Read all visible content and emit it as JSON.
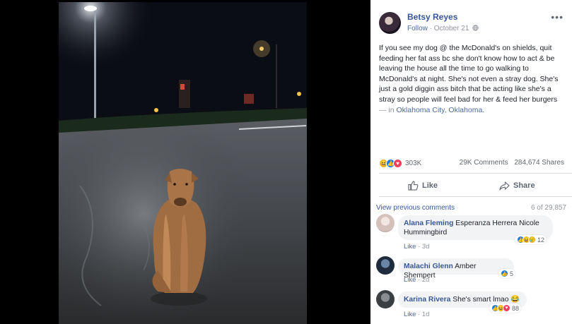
{
  "post": {
    "author": "Betsy Reyes",
    "follow": "Follow",
    "date": "October 21",
    "text": "If you see my dog @ the McDonald's on shields, quit feeding her fat ass bc she don't know how to act & be leaving the house all the time to go walking to McDonald's at night. She's not even a stray dog. She's just a gold diggin ass bitch that be acting like she's a stray so people will feel bad for her & feed her burgers",
    "location_prefix": "— in",
    "location": "Oklahoma City, Oklahoma.",
    "more_icon": "•••"
  },
  "stats": {
    "reactions": "303K",
    "comments": "29K Comments",
    "shares": "284,674 Shares"
  },
  "actions": {
    "like": "Like",
    "share": "Share"
  },
  "comments_header": {
    "view_previous": "View previous comments",
    "count": "6 of 29,857"
  },
  "comments": [
    {
      "name": "Alana Fleming",
      "text": "Esperanza Herrera Nicole Hummingbird",
      "like": "Like",
      "time": "3d",
      "reactions": "12"
    },
    {
      "name": "Malachi Glenn",
      "text": "Amber Shempert",
      "like": "Like",
      "time": "2d",
      "reactions": "5"
    },
    {
      "name": "Karina Rivera",
      "text": "She's smart lmao 😂",
      "like": "Like",
      "time": "1d",
      "reactions": "88"
    }
  ],
  "colors": {
    "link": "#365899",
    "muted": "#90949c",
    "like_blue": "#1877f2",
    "love_red": "#f33e58",
    "haha_yellow": "#f7b125"
  }
}
